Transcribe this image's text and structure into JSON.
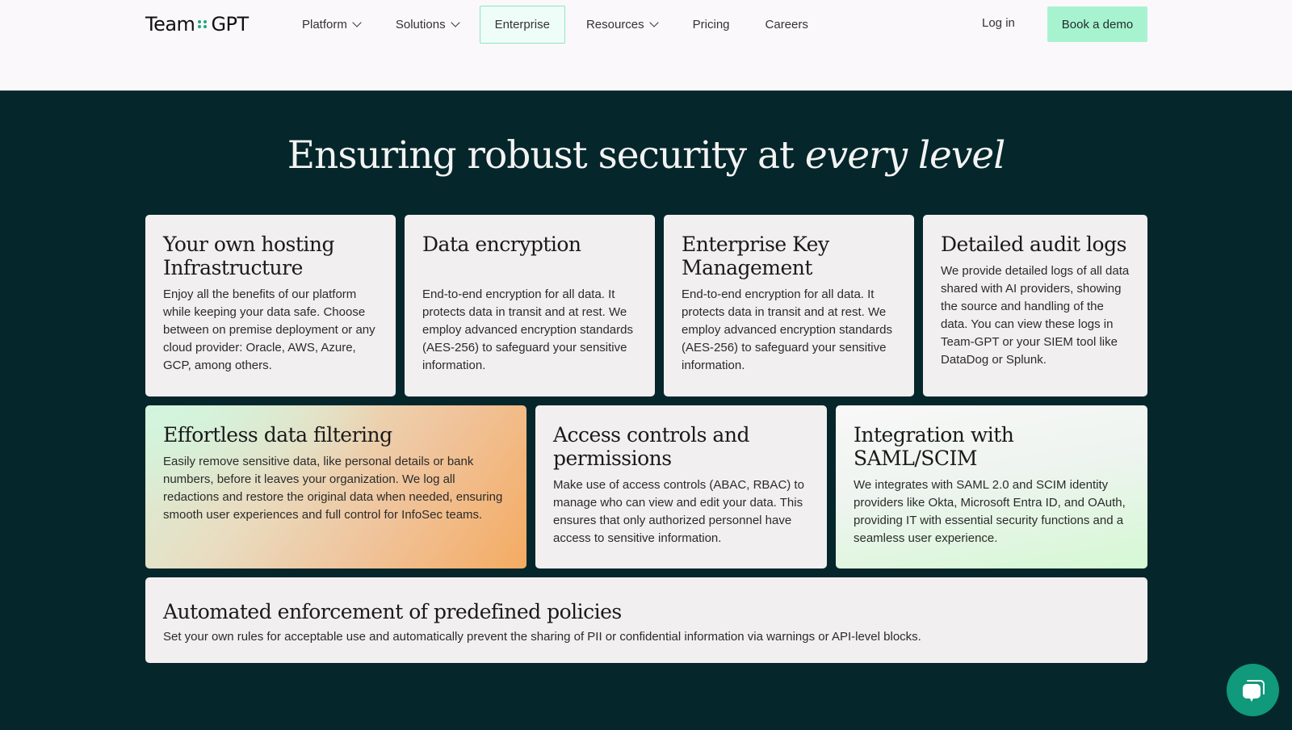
{
  "header": {
    "logo_left": "Team",
    "logo_right": "GPT",
    "nav": [
      {
        "label": "Platform",
        "dropdown": true
      },
      {
        "label": "Solutions",
        "dropdown": true
      },
      {
        "label": "Enterprise",
        "dropdown": false,
        "active": true
      },
      {
        "label": "Resources",
        "dropdown": true
      },
      {
        "label": "Pricing",
        "dropdown": false
      },
      {
        "label": "Careers",
        "dropdown": false
      }
    ],
    "login_label": "Log in",
    "demo_label": "Book a demo"
  },
  "hero": {
    "title_plain": "Ensuring robust security at ",
    "title_italic": "every level"
  },
  "cards": [
    {
      "title": "Your own hosting Infrastructure",
      "body": "Enjoy all the benefits of our platform while keeping your data safe. Choose between on premise deployment or any cloud provider: Oracle, AWS, Azure, GCP, among others."
    },
    {
      "title": "Data encryption",
      "body": "End-to-end encryption for all data. It protects data in transit and at rest. We employ advanced encryption standards (AES-256) to safeguard your sensitive information."
    },
    {
      "title": "Enterprise Key Management",
      "body": "End-to-end encryption for all data. It protects data in transit and at rest. We employ advanced encryption standards (AES-256) to safeguard your sensitive information."
    },
    {
      "title": "Detailed audit logs",
      "body": "We provide detailed logs of all data shared with AI providers, showing the source and handling of the data. You can view these logs in Team-GPT or your SIEM tool like DataDog or Splunk."
    },
    {
      "title": "Effortless data filtering",
      "body": "Easily remove sensitive data, like personal details or bank numbers, before it leaves your organization. We log all redactions and restore the original data when needed, ensuring smooth user experiences and full control for InfoSec teams."
    },
    {
      "title": "Access controls and permissions",
      "body": "Make use of access controls (ABAC, RBAC) to manage who can view and edit your data. This ensures that only authorized personnel have access to sensitive information."
    },
    {
      "title": "Integration with SAML/SCIM",
      "body": "We integrates with SAML 2.0 and SCIM identity providers like Okta, Microsoft Entra ID, and OAuth, providing IT with essential security functions and a seamless user experience."
    },
    {
      "title": "Automated enforcement of predefined policies",
      "body": "Set your own rules for acceptable use and automatically prevent the sharing of PII or confidential information via warnings or API-level blocks."
    }
  ],
  "chat_widget": {
    "icon": "chat-bubbles-icon"
  },
  "colors": {
    "page_bg": "#05262a",
    "accent": "#a7f3d0",
    "active_border": "#8de4c3",
    "chat_button": "#10997a"
  }
}
